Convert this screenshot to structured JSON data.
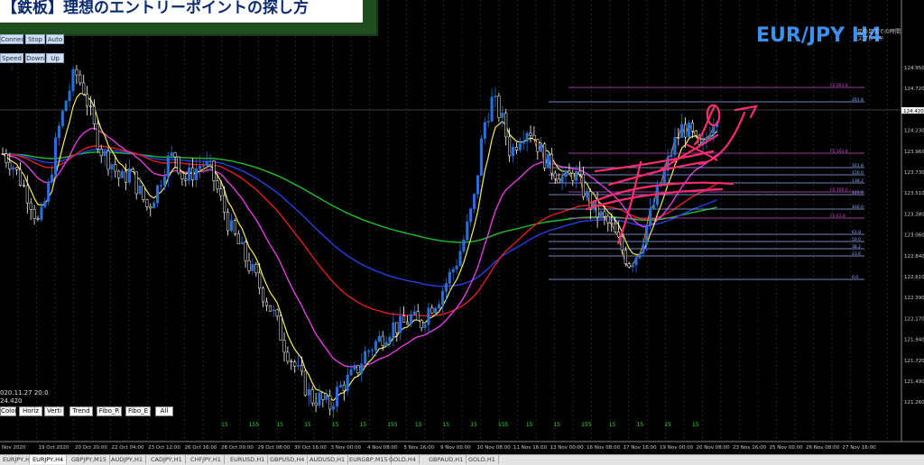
{
  "banner": {
    "title": "【鉄板】理想のエントリーポイントの探し方"
  },
  "symbol": {
    "label": "EUR/JPY  H4"
  },
  "spread": {
    "line1": "足の足までの時間",
    "line2": "スプレッド"
  },
  "controls": [
    {
      "label": "Connect",
      "name": "connect-button"
    },
    {
      "label": "Stop",
      "name": "stop-button"
    },
    {
      "label": "Auto",
      "name": "auto-button"
    },
    {
      "label": "Speed 1",
      "name": "speed-button"
    },
    {
      "label": "Down",
      "name": "down-button"
    },
    {
      "label": "Up",
      "name": "up-button"
    }
  ],
  "tools": [
    {
      "label": "Color",
      "name": "color-tool-button"
    },
    {
      "label": "Horiz",
      "name": "horiz-tool-button"
    },
    {
      "label": "Verti",
      "name": "verti-tool-button"
    },
    {
      "label": "Trend",
      "name": "trend-tool-button"
    },
    {
      "label": "Fibo_R",
      "name": "fibo-r-tool-button"
    },
    {
      "label": "Fibo_E",
      "name": "fibo-e-tool-button"
    },
    {
      "label": "All",
      "name": "all-tool-button"
    }
  ],
  "info": {
    "datetime": "020.11.27 20:0",
    "price": "24.420"
  },
  "tabs": [
    "EURJPY,H1",
    "EURJPY,H4",
    "GBPJPY,M15",
    "AUDJPY,H1",
    "CADJPY,H1",
    "CHFJPY,H1",
    "EURUSD,H1",
    "GBPUSD,H4",
    "AUDUSD,H1",
    "EURGBP,M15",
    "GOLD,H4",
    "GBPAUD,H1",
    "GOLD,H1"
  ],
  "colors": {
    "background": "#000000",
    "bull": "#2a6fd6",
    "bear": "#ffffff",
    "ema_fast": "#f7ee4a",
    "ema_mid": "#e23ce0",
    "ema_slow": "#1fbf2a",
    "red_ma": "#e02020",
    "blue_ma": "#2440e6",
    "orange": "#ff8c1a",
    "hand_pink": "#ff2d6e",
    "fibo": "#9fb7ff"
  },
  "chart_data": {
    "type": "candlestick",
    "price_axis": {
      "ticks": [
        "124.950",
        "124.720",
        "124.420",
        "124.230",
        "123.960",
        "123.730",
        "123.510",
        "123.280",
        "123.060",
        "122.840",
        "122.610",
        "122.390",
        "122.170",
        "121.940",
        "121.720",
        "121.490",
        "121.260"
      ],
      "current": "124.420"
    },
    "time_axis": [
      "Nov 2020",
      "19 Oct 2020",
      "20 Oct 20:00",
      "22 Oct 04:00",
      "23 Oct 12:00",
      "26 Oct 16:00",
      "28 Oct 00:00",
      "29 Oct 08:00",
      "30 Oct 16:00",
      "3 Nov 00:00",
      "4 Nov 08:00",
      "5 Nov 16:00",
      "9 Nov 00:00",
      "10 Nov 08:00",
      "11 Nov 16:00",
      "13 Nov 00:00",
      "16 Nov 08:00",
      "17 Nov 16:00",
      "19 Nov 00:00",
      "20 Nov 08:00",
      "23 Nov 16:00",
      "25 Nov 00:00",
      "26 Nov 08:00",
      "27 Nov 16:00"
    ],
    "bottom_marks": [
      "15",
      "155",
      "15",
      "15",
      "15",
      "15",
      "155",
      "15",
      "15",
      "15",
      "155",
      "15",
      "15",
      "155",
      "15",
      "15",
      "15",
      "15"
    ],
    "fibo_levels": [
      {
        "label": "FE 261.8",
        "color": "#d24bd2"
      },
      {
        "label": "261.8",
        "color": "#8fb0ff"
      },
      {
        "label": "FE 161.8",
        "color": "#d24bd2"
      },
      {
        "label": "161.8",
        "color": "#8fb0ff"
      },
      {
        "label": "150.0",
        "color": "#8fb0ff"
      },
      {
        "label": "138.2",
        "color": "#8fb0ff"
      },
      {
        "label": "FE 100.0",
        "color": "#d24bd2"
      },
      {
        "label": "123.6",
        "color": "#8fb0ff"
      },
      {
        "label": "100.0",
        "color": "#8fb0ff"
      },
      {
        "label": "FE 61.8",
        "color": "#d24bd2"
      },
      {
        "label": "61.8",
        "color": "#8fb0ff"
      },
      {
        "label": "50.0",
        "color": "#8fb0ff"
      },
      {
        "label": "38.2",
        "color": "#8fb0ff"
      },
      {
        "label": "23.6",
        "color": "#8fb0ff"
      },
      {
        "label": "0.0",
        "color": "#8fb0ff"
      }
    ],
    "price_trace": [
      124.0,
      123.9,
      123.7,
      123.5,
      123.2,
      123.6,
      124.2,
      124.6,
      124.9,
      124.7,
      124.3,
      124.0,
      123.9,
      123.7,
      123.8,
      123.6,
      123.4,
      123.6,
      123.9,
      124.0,
      123.7,
      123.8,
      123.9,
      123.8,
      123.5,
      123.2,
      123.0,
      122.8,
      122.6,
      122.4,
      122.2,
      121.9,
      121.7,
      121.5,
      121.3,
      121.3,
      121.2,
      121.4,
      121.5,
      121.6,
      121.8,
      121.9,
      122.0,
      122.1,
      122.1,
      122.2,
      122.1,
      122.3,
      122.4,
      122.6,
      122.8,
      123.1,
      123.5,
      124.3,
      124.6,
      124.4,
      124.0,
      124.2,
      124.3,
      124.1,
      123.9,
      123.8,
      123.7,
      123.8,
      123.6,
      123.4,
      123.3,
      123.2,
      123.0,
      122.8,
      122.9,
      123.2,
      123.5,
      123.8,
      124.1,
      124.3,
      124.2,
      124.0,
      124.3,
      124.5
    ]
  }
}
